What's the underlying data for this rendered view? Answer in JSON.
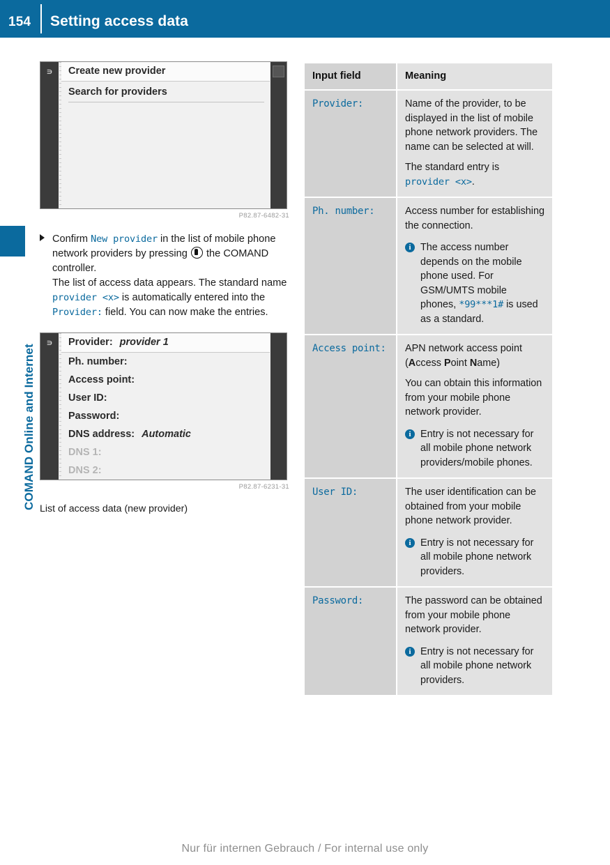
{
  "header": {
    "page_number": "154",
    "title": "Setting access data"
  },
  "side_tab": {
    "chapter": "COMAND Online and Internet"
  },
  "figures": [
    {
      "id": "fig-create-new-provider",
      "image_code": "P82.87-6482-31",
      "back_icon": "back-arrow-icon",
      "title_row": "Create new provider",
      "rows": [
        "Search for providers"
      ],
      "caption": ""
    },
    {
      "id": "fig-access-data-list",
      "image_code": "P82.87-6231-31",
      "back_icon": "back-arrow-icon",
      "title_row_label": "Provider:",
      "title_row_value": "provider 1",
      "rows": [
        {
          "label": "Ph. number:",
          "value": "",
          "dim": false
        },
        {
          "label": "Access point:",
          "value": "",
          "dim": false
        },
        {
          "label": "User ID:",
          "value": "",
          "dim": false
        },
        {
          "label": "Password:",
          "value": "",
          "dim": false
        },
        {
          "label": "DNS address:",
          "value": "Automatic",
          "dim": false
        },
        {
          "label": "DNS 1:",
          "value": "",
          "dim": true
        },
        {
          "label": "DNS 2:",
          "value": "",
          "dim": true
        }
      ],
      "caption": "List of access data (new provider)"
    }
  ],
  "step": {
    "part1": "Confirm ",
    "mono1": "New provider",
    "part2": " in the list of mobile phone network providers by pressing ",
    "icon": "comand-controller-press-icon",
    "part3": " the COMAND controller.",
    "part4": "The list of access data appears. The standard name ",
    "mono2": "provider <x>",
    "part5": " is automatically entered into the ",
    "mono3": "Provider:",
    "part6": " field. You can now make the entries."
  },
  "table": {
    "headers": [
      "Input field",
      "Meaning"
    ],
    "rows": [
      {
        "key": "Provider:",
        "paragraphs": [
          {
            "type": "text",
            "runs": [
              {
                "t": "Name of the provider, to be displayed in the list of mobile phone network providers. The name can be selected at will."
              }
            ]
          },
          {
            "type": "text",
            "runs": [
              {
                "t": "The standard entry is "
              },
              {
                "t": "provider <x>",
                "style": "mono"
              },
              {
                "t": "."
              }
            ]
          }
        ]
      },
      {
        "key": "Ph. number:",
        "paragraphs": [
          {
            "type": "text",
            "runs": [
              {
                "t": "Access number for establishing the connection."
              }
            ]
          },
          {
            "type": "note",
            "runs": [
              {
                "t": "The access number depends on the mobile phone used. For GSM/UMTS mobile phones, "
              },
              {
                "t": "*99***1#",
                "style": "mono"
              },
              {
                "t": " is used as a standard."
              }
            ]
          }
        ]
      },
      {
        "key": "Access point:",
        "paragraphs": [
          {
            "type": "text",
            "runs": [
              {
                "t": "APN network access point ("
              },
              {
                "t": "A",
                "style": "bold"
              },
              {
                "t": "ccess "
              },
              {
                "t": "P",
                "style": "bold"
              },
              {
                "t": "oint "
              },
              {
                "t": "N",
                "style": "bold"
              },
              {
                "t": "ame)"
              }
            ]
          },
          {
            "type": "text",
            "runs": [
              {
                "t": "You can obtain this information from your mobile phone network provider."
              }
            ]
          },
          {
            "type": "note",
            "runs": [
              {
                "t": "Entry is not necessary for all mobile phone network providers/mobile phones."
              }
            ]
          }
        ]
      },
      {
        "key": "User ID:",
        "paragraphs": [
          {
            "type": "text",
            "runs": [
              {
                "t": "The user identification can be obtained from your mobile phone network provider."
              }
            ]
          },
          {
            "type": "note",
            "runs": [
              {
                "t": "Entry is not necessary for all mobile phone network providers."
              }
            ]
          }
        ]
      },
      {
        "key": "Password:",
        "paragraphs": [
          {
            "type": "text",
            "runs": [
              {
                "t": "The password can be obtained from your mobile phone network provider."
              }
            ]
          },
          {
            "type": "note",
            "runs": [
              {
                "t": "Entry is not necessary for all mobile phone network providers."
              }
            ]
          }
        ]
      }
    ]
  },
  "footer": {
    "text": "Nur für internen Gebrauch / For internal use only"
  },
  "colors": {
    "brand_blue": "#0b6a9e",
    "table_key_bg": "#d2d2d2",
    "table_val_bg": "#e2e2e2"
  }
}
